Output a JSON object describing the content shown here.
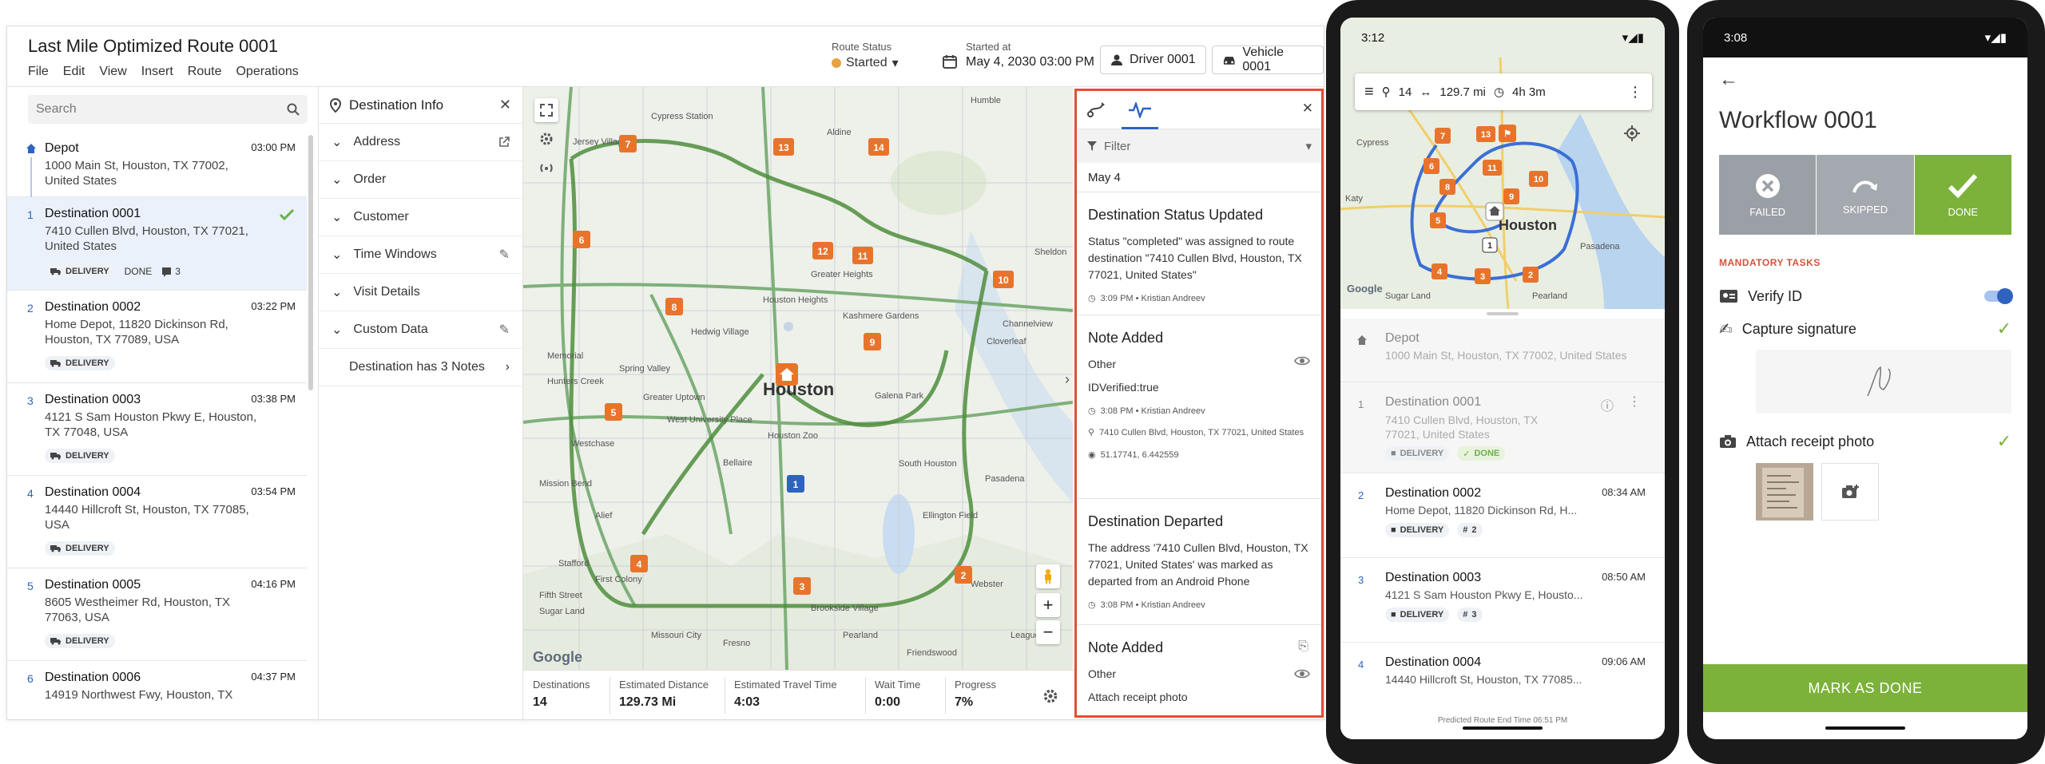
{
  "desktop": {
    "title": "Last Mile Optimized Route 0001",
    "menu": [
      "File",
      "Edit",
      "View",
      "Insert",
      "Route",
      "Operations"
    ],
    "route_status_label": "Route Status",
    "route_status_value": "Started",
    "started_label": "Started at",
    "started_value": "May 4, 2030 03:00 PM",
    "driver": "Driver 0001",
    "vehicle": "Vehicle 0001",
    "search_placeholder": "Search",
    "destinations": [
      {
        "num": "",
        "name": "Depot",
        "time": "03:00 PM",
        "address": "1000 Main St, Houston, TX 77002, United States"
      },
      {
        "num": "1",
        "name": "Destination 0001",
        "time": "",
        "address": "7410 Cullen Blvd, Houston, TX 77021, United States",
        "tag": "DELIVERY",
        "status": "DONE",
        "notes": "3"
      },
      {
        "num": "2",
        "name": "Destination 0002",
        "time": "03:22 PM",
        "address": "Home Depot, 11820 Dickinson Rd, Houston, TX 77089, USA",
        "tag": "DELIVERY"
      },
      {
        "num": "3",
        "name": "Destination 0003",
        "time": "03:38 PM",
        "address": "4121 S Sam Houston Pkwy E, Houston, TX 77048, USA",
        "tag": "DELIVERY"
      },
      {
        "num": "4",
        "name": "Destination 0004",
        "time": "03:54 PM",
        "address": "14440 Hillcroft St, Houston, TX 77085, USA",
        "tag": "DELIVERY"
      },
      {
        "num": "5",
        "name": "Destination 0005",
        "time": "04:16 PM",
        "address": "8605 Westheimer Rd, Houston, TX 77063, USA",
        "tag": "DELIVERY"
      },
      {
        "num": "6",
        "name": "Destination 0006",
        "time": "04:37 PM",
        "address": "14919 Northwest Fwy, Houston, TX"
      }
    ],
    "info": {
      "title": "Destination Info",
      "rows": [
        "Address",
        "Order",
        "Customer",
        "Time Windows",
        "Visit Details",
        "Custom Data"
      ],
      "notes": "Destination has 3 Notes"
    },
    "map": {
      "city": "Houston",
      "labels": [
        "Jersey Village",
        "Cypress Station",
        "Aldine",
        "Humble",
        "Sheldon",
        "Channelview",
        "Cloverleaf",
        "Galena Park",
        "Pasadena",
        "South Houston",
        "Bellaire",
        "West University Place",
        "Memorial",
        "Spring Valley",
        "Houston Heights",
        "Greater Heights",
        "Houston Zoo",
        "Mission Bend",
        "Alief",
        "Missouri City",
        "Fresno",
        "Stafford",
        "Sugar Land",
        "Brookside Village",
        "Pearland",
        "Friendswood",
        "Webster",
        "League City",
        "First Colony",
        "Fifth Street",
        "Ellington Field",
        "Greater Uptown",
        "Westchase",
        "Hedwig Village",
        "Hunters Creek",
        "Kashmere Gardens"
      ],
      "google": "Google"
    },
    "footer": [
      {
        "label": "Destinations",
        "value": "14"
      },
      {
        "label": "Estimated Distance",
        "value": "129.73 Mi"
      },
      {
        "label": "Estimated Travel Time",
        "value": "4:03"
      },
      {
        "label": "Wait Time",
        "value": "0:00"
      },
      {
        "label": "Progress",
        "value": "7%"
      }
    ],
    "activity": {
      "filter": "Filter",
      "day": "May 4",
      "items": [
        {
          "title": "Destination Status Updated",
          "type": "",
          "body": "Status \"completed\" was assigned to route destination \"7410 Cullen Blvd, Houston, TX 77021, United States\"",
          "meta": "3:09 PM • Kristian Andreev"
        },
        {
          "title": "Note Added",
          "type": "Other",
          "body": "IDVerified:true",
          "meta": "3:08 PM • Kristian Andreev",
          "place": "7410 Cullen Blvd, Houston, TX 77021, United States",
          "coords": "51.17741, 6.442559"
        },
        {
          "title": "Destination Departed",
          "type": "",
          "body": "The address '7410 Cullen Blvd, Houston, TX 77021, United States' was marked as departed from an Android Phone",
          "meta": "3:08 PM • Kristian Andreev"
        },
        {
          "title": "Note Added",
          "type": "Other",
          "body": "Attach receipt photo",
          "meta": ""
        }
      ]
    }
  },
  "phone1": {
    "time": "3:12",
    "stops": "14",
    "distance": "129.7 mi",
    "duration": "4h 3m",
    "city": "Houston",
    "labels": [
      "Cypress",
      "Sugar Land",
      "Pearland",
      "Pasadena",
      "Katy"
    ],
    "list": [
      {
        "num": "",
        "name": "Depot",
        "time": "",
        "address": "1000 Main St, Houston, TX 77002, United States"
      },
      {
        "num": "1",
        "name": "Destination 0001",
        "time": "",
        "address": "7410 Cullen Blvd, Houston, TX 77021, United States",
        "tag": "DELIVERY",
        "status": "DONE"
      },
      {
        "num": "2",
        "name": "Destination 0002",
        "time": "08:34 AM",
        "address": "Home Depot, 11820 Dickinson Rd, H...",
        "tag": "DELIVERY",
        "count": "2"
      },
      {
        "num": "3",
        "name": "Destination 0003",
        "time": "08:50 AM",
        "address": "4121 S Sam Houston Pkwy E, Housto...",
        "tag": "DELIVERY",
        "count": "3"
      },
      {
        "num": "4",
        "name": "Destination 0004",
        "time": "09:06 AM",
        "address": "14440 Hillcroft St, Houston, TX 77085..."
      }
    ],
    "footer": "Predicted Route End Time 06:51 PM"
  },
  "phone2": {
    "time": "3:08",
    "title": "Workflow 0001",
    "buttons": [
      "FAILED",
      "SKIPPED",
      "DONE"
    ],
    "section": "MANDATORY TASKS",
    "tasks": [
      "Verify ID",
      "Capture signature",
      "Attach receipt photo"
    ],
    "action": "MARK AS DONE"
  },
  "colors": {
    "accent": "#2e63c0",
    "done": "#7cb23a",
    "pin": "#e8742c",
    "alert": "#e05036",
    "route": "#3f8a3a"
  }
}
